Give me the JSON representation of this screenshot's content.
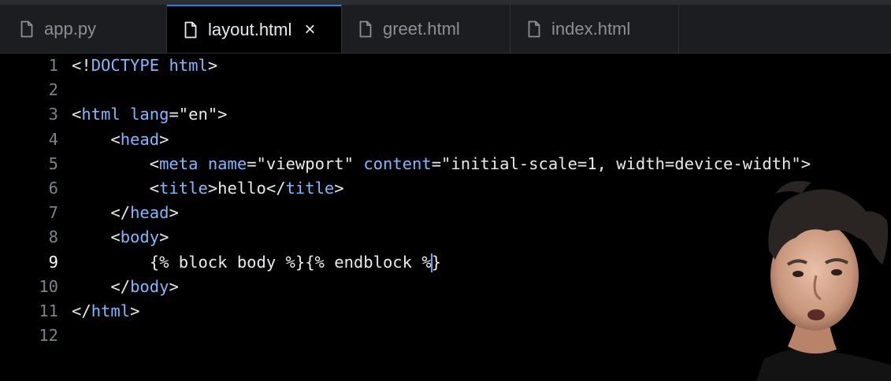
{
  "tabs": [
    {
      "label": "app.py",
      "active": false
    },
    {
      "label": "layout.html",
      "active": true,
      "close": "×"
    },
    {
      "label": "greet.html",
      "active": false
    },
    {
      "label": "index.html",
      "active": false
    }
  ],
  "editor": {
    "current_line": 9,
    "lines": [
      {
        "n": "1",
        "text": "<!DOCTYPE html>"
      },
      {
        "n": "2",
        "text": ""
      },
      {
        "n": "3",
        "text": "<html lang=\"en\">"
      },
      {
        "n": "4",
        "text": "    <head>"
      },
      {
        "n": "5",
        "text": "        <meta name=\"viewport\" content=\"initial-scale=1, width=device-width\">"
      },
      {
        "n": "6",
        "text": "        <title>hello</title>"
      },
      {
        "n": "7",
        "text": "    </head>"
      },
      {
        "n": "8",
        "text": "    <body>"
      },
      {
        "n": "9",
        "text": "        {% block body %}{% endblock %}"
      },
      {
        "n": "10",
        "text": "    </body>"
      },
      {
        "n": "11",
        "text": "</html>"
      },
      {
        "n": "12",
        "text": ""
      }
    ]
  },
  "colors": {
    "background": "#000000",
    "tag": "#7fb8ff",
    "text": "#e8eaed",
    "line_number": "#7d8288",
    "cursor": "#5aa0ff"
  }
}
